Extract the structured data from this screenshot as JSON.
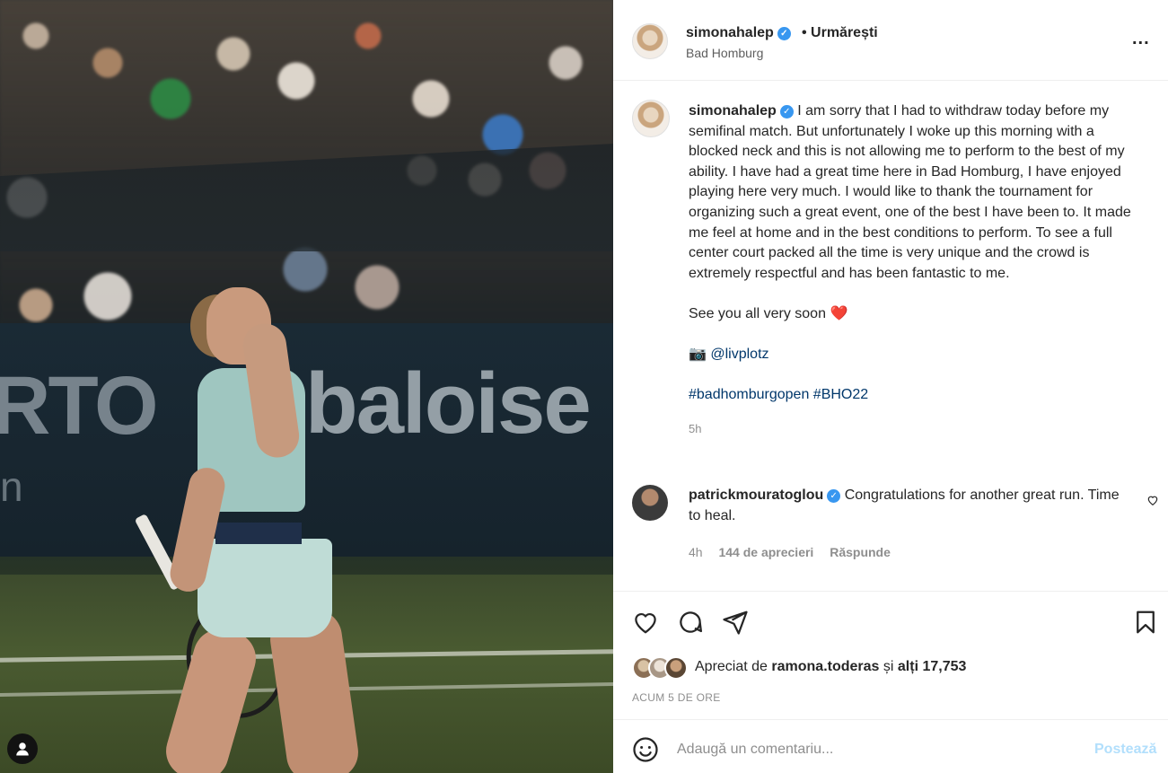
{
  "photo": {
    "banner_left_text": "RTO",
    "banner_right_text": "baloise",
    "banner_small_text": "n"
  },
  "header": {
    "username": "simonahalep",
    "follow_status": "• Urmărești",
    "location": "Bad Homburg",
    "more_label": "..."
  },
  "caption": {
    "username": "simonahalep",
    "text": "I am sorry that I had to withdraw today before my semifinal match. But unfortunately I woke up this morning with a blocked neck and this is not allowing me to perform to the best of my ability. I have had a great time here in Bad Homburg, I have enjoyed playing here very much. I would like to thank the tournament for organizing such a great event, one of the best I have been to. It made me feel at home and in the best conditions to perform. To see a full center court packed all the time is very unique and the crowd is extremely respectful and has been fantastic to me.",
    "see_you": "See you all very soon",
    "heart_emoji": "❤️",
    "camera_emoji": "📷",
    "photo_credit": "@livplotz",
    "hashtag_1": "#badhomburgopen",
    "hashtag_2": "#BHO22",
    "time": "5h"
  },
  "comment": {
    "username": "patrickmouratoglou",
    "text": "Congratulations for another great run. Time to heal.",
    "time": "4h",
    "likes": "144 de aprecieri",
    "reply": "Răspunde"
  },
  "actions": {
    "liked_by_prefix": "Apreciat de",
    "liked_by_user": "ramona.toderas",
    "liked_by_joiner": "și",
    "liked_by_others": "alți 17,753",
    "post_time": "ACUM 5 DE ORE"
  },
  "composer": {
    "placeholder": "Adaugă un comentariu...",
    "post_label": "Postează"
  },
  "colors": {
    "verified": "#3897f0",
    "link": "#00376b",
    "post_button_disabled": "#b2dffc",
    "secondary_text": "#8e8e8e"
  },
  "icons": [
    "heart-icon",
    "comment-icon",
    "share-icon",
    "bookmark-icon",
    "emoji-icon",
    "more-icon",
    "verified-icon",
    "user-avatar-icon"
  ]
}
